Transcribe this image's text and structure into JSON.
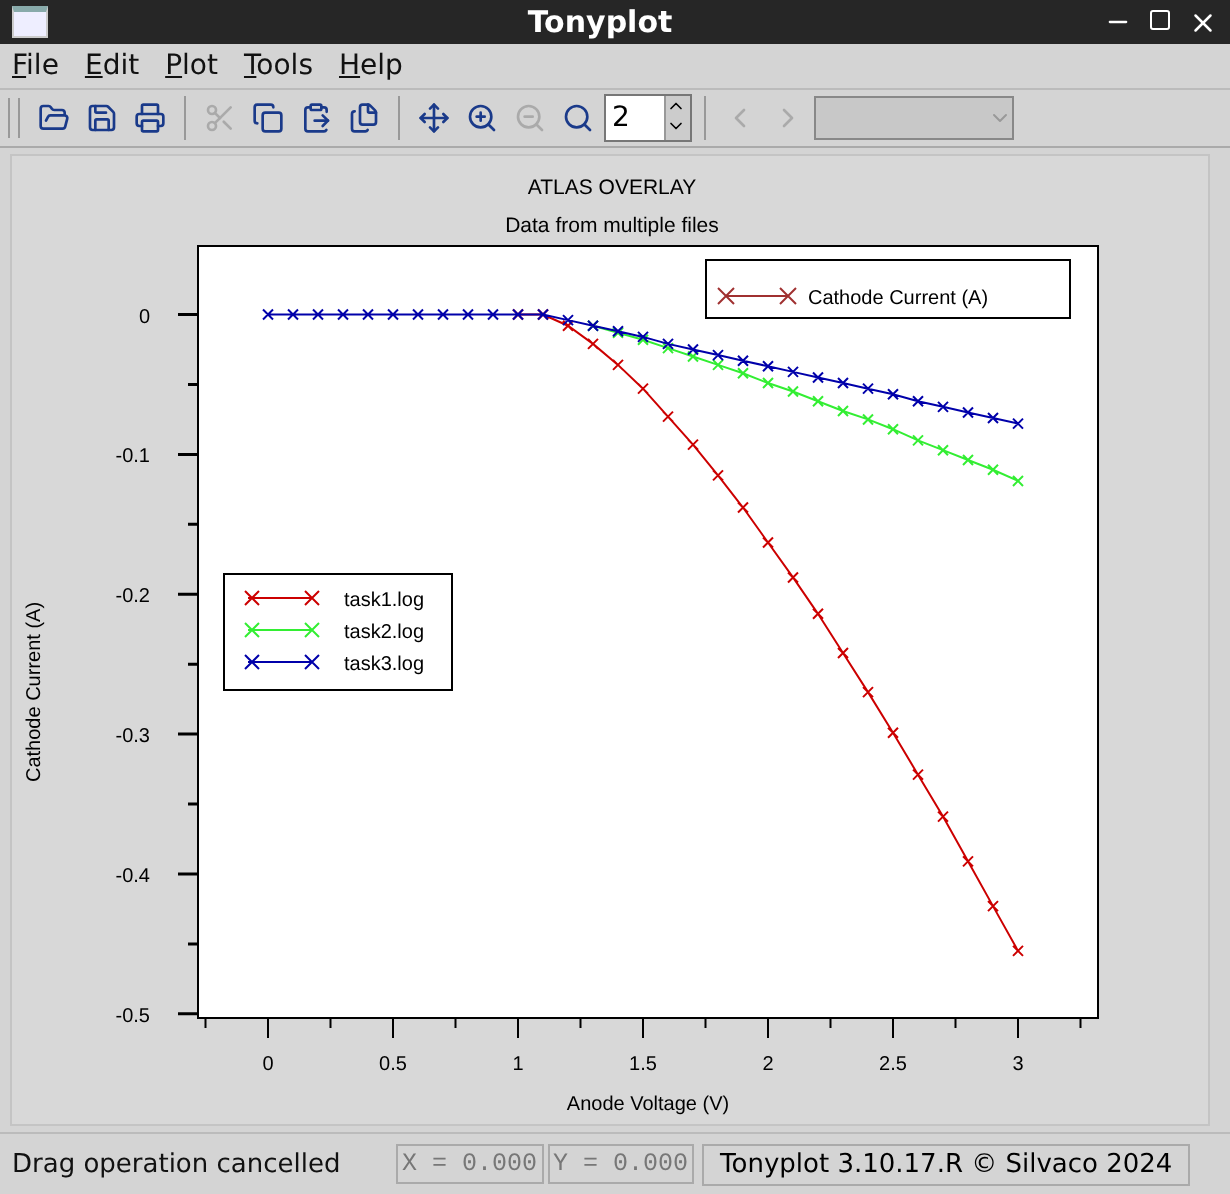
{
  "window": {
    "title": "Tonyplot"
  },
  "menu": [
    {
      "label": "File"
    },
    {
      "label": "Edit"
    },
    {
      "label": "Plot"
    },
    {
      "label": "Tools"
    },
    {
      "label": "Help"
    }
  ],
  "toolbar": {
    "groups": [
      [
        {
          "disabled": false
        },
        {
          "disabled": false
        },
        {
          "disabled": false
        }
      ],
      [
        {
          "disabled": true
        },
        {
          "disabled": false
        },
        {
          "disabled": false
        },
        {
          "disabled": false
        }
      ],
      [
        {
          "disabled": false
        },
        {
          "disabled": false
        },
        {
          "disabled": true
        },
        {
          "disabled": false
        }
      ]
    ],
    "spinner": {
      "value": "2"
    },
    "nav": [
      {
        "disabled": true
      },
      {
        "disabled": true
      }
    ],
    "combo": {
      "disabled": true
    }
  },
  "plot": {
    "chart_data": {
      "type": "line",
      "title": "ATLAS OVERLAY",
      "subtitle": "Data from multiple files",
      "xlabel": "Anode Voltage (V)",
      "ylabel": "Cathode Current (A)",
      "x": [
        0,
        0.1,
        0.2,
        0.3,
        0.4,
        0.5,
        0.6,
        0.7,
        0.8,
        0.9,
        1,
        1.1,
        1.2,
        1.3,
        1.4,
        1.5,
        1.6,
        1.7,
        1.8,
        1.9,
        2,
        2.1,
        2.2,
        2.3,
        2.4,
        2.5,
        2.6,
        2.7,
        2.8,
        2.9,
        3
      ],
      "series": [
        {
          "name": "task1.log",
          "color": "#cc0000",
          "marker": "x",
          "values": [
            null,
            null,
            null,
            null,
            null,
            null,
            null,
            null,
            null,
            null,
            0,
            0,
            -0.008,
            -0.021,
            -0.036,
            -0.053,
            -0.073,
            -0.093,
            -0.115,
            -0.138,
            -0.163,
            -0.188,
            -0.214,
            -0.242,
            -0.27,
            -0.299,
            -0.329,
            -0.359,
            -0.391,
            -0.423,
            -0.455
          ]
        },
        {
          "name": "task2.log",
          "color": "#33ee33",
          "marker": "x",
          "values": [
            null,
            null,
            null,
            null,
            null,
            null,
            null,
            null,
            null,
            null,
            null,
            null,
            null,
            -0.008,
            -0.013,
            -0.018,
            -0.024,
            -0.03,
            -0.036,
            -0.042,
            -0.049,
            -0.055,
            -0.062,
            -0.069,
            -0.075,
            -0.082,
            -0.09,
            -0.097,
            -0.104,
            -0.111,
            -0.119
          ]
        },
        {
          "name": "task3.log",
          "color": "#0000aa",
          "marker": "x",
          "values": [
            0,
            0,
            0,
            0,
            0,
            0,
            0,
            0,
            0,
            0,
            0,
            0,
            -0.004,
            -0.008,
            -0.012,
            -0.016,
            -0.021,
            -0.025,
            -0.029,
            -0.033,
            -0.037,
            -0.041,
            -0.045,
            -0.049,
            -0.053,
            -0.057,
            -0.062,
            -0.066,
            -0.07,
            -0.074,
            -0.078
          ]
        }
      ],
      "xlim": [
        -0.28,
        3.32
      ],
      "ylim": [
        -0.503,
        0.049
      ],
      "xticks": [
        {
          "value": 0,
          "label": "0"
        },
        {
          "value": 0.5,
          "label": "0.5"
        },
        {
          "value": 1,
          "label": "1"
        },
        {
          "value": 1.5,
          "label": "1.5"
        },
        {
          "value": 2,
          "label": "2"
        },
        {
          "value": 2.5,
          "label": "2.5"
        },
        {
          "value": 3,
          "label": "3"
        }
      ],
      "yticks": [
        {
          "value": 0,
          "label": "0"
        },
        {
          "value": -0.1,
          "label": "-0.1"
        },
        {
          "value": -0.2,
          "label": "-0.2"
        },
        {
          "value": -0.3,
          "label": "-0.3"
        },
        {
          "value": -0.4,
          "label": "-0.4"
        },
        {
          "value": -0.5,
          "label": "-0.5"
        }
      ],
      "legend": true,
      "annotations": [
        {
          "text": "Cathode Current (A)"
        }
      ]
    }
  },
  "status_bar": {
    "message": "Drag operation cancelled",
    "x": "X = 0.000",
    "y": "Y = 0.000",
    "version": "Tonyplot 3.10.17.R © Silvaco 2024"
  }
}
